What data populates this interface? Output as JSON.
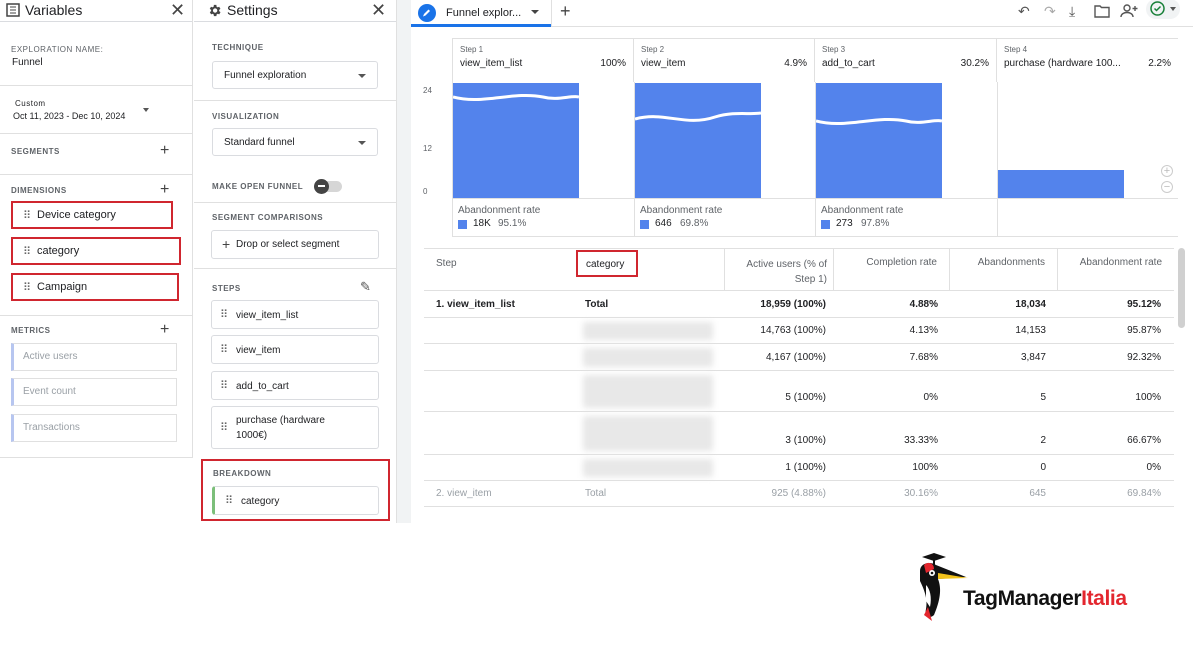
{
  "variables": {
    "title": "Variables",
    "exploration_name_label": "EXPLORATION NAME:",
    "exploration_name": "Funnel",
    "date_label": "Custom",
    "date_range": "Oct 11, 2023 - Dec 10, 2024",
    "segments_label": "SEGMENTS",
    "dimensions_label": "DIMENSIONS",
    "dimensions": [
      "Device category",
      "category",
      "Campaign"
    ],
    "metrics_label": "METRICS",
    "metrics": [
      "Active users",
      "Event count",
      "Transactions"
    ]
  },
  "settings": {
    "title": "Settings",
    "technique_label": "TECHNIQUE",
    "technique": "Funnel exploration",
    "visualization_label": "VISUALIZATION",
    "visualization": "Standard funnel",
    "open_funnel_label": "MAKE OPEN FUNNEL",
    "segment_comparisons_label": "SEGMENT COMPARISONS",
    "segment_drop": "Drop or select segment",
    "steps_label": "STEPS",
    "steps": [
      "view_item_list",
      "view_item",
      "add_to_cart",
      "purchase (hardware 1000€)"
    ],
    "breakdown_label": "BREAKDOWN",
    "breakdown": "category"
  },
  "main": {
    "tab_label": "Funnel explor...",
    "y_ticks": [
      "24",
      "12",
      "0"
    ],
    "steps": [
      {
        "step": "Step 1",
        "name": "view_item_list",
        "pct": "100%",
        "bar": 1.0,
        "abandon_label": "Abandonment rate",
        "abandon_value": "18K",
        "abandon_rate": "95.1%"
      },
      {
        "step": "Step 2",
        "name": "view_item",
        "pct": "4.9%",
        "bar": 1.0,
        "abandon_label": "Abandonment rate",
        "abandon_value": "646",
        "abandon_rate": "69.8%"
      },
      {
        "step": "Step 3",
        "name": "add_to_cart",
        "pct": "30.2%",
        "bar": 1.0,
        "abandon_label": "Abandonment rate",
        "abandon_value": "273",
        "abandon_rate": "97.8%"
      },
      {
        "step": "Step 4",
        "name": "purchase (hardware 100...",
        "pct": "2.2%",
        "bar": 0.24
      }
    ],
    "table": {
      "headers": [
        "Step",
        "category",
        "Active users (% of Step 1)",
        "Completion rate",
        "Abandonments",
        "Abandonment rate"
      ],
      "rows": [
        {
          "step": "1. view_item_list",
          "category": "Total",
          "active": "18,959 (100%)",
          "completion": "4.88%",
          "abandonments": "18,034",
          "rate": "95.12%"
        },
        {
          "step": "",
          "category": "",
          "active": "14,763 (100%)",
          "completion": "4.13%",
          "abandonments": "14,153",
          "rate": "95.87%"
        },
        {
          "step": "",
          "category": "",
          "active": "4,167 (100%)",
          "completion": "7.68%",
          "abandonments": "3,847",
          "rate": "92.32%"
        },
        {
          "step": "",
          "category": "",
          "active": "5 (100%)",
          "completion": "0%",
          "abandonments": "5",
          "rate": "100%"
        },
        {
          "step": "",
          "category": "",
          "active": "3 (100%)",
          "completion": "33.33%",
          "abandonments": "2",
          "rate": "66.67%"
        },
        {
          "step": "",
          "category": "",
          "active": "1 (100%)",
          "completion": "100%",
          "abandonments": "0",
          "rate": "0%"
        },
        {
          "step": "2. view_item",
          "category": "Total",
          "active": "925 (4.88%)",
          "completion": "30.16%",
          "abandonments": "645",
          "rate": "69.84%"
        }
      ]
    }
  },
  "logo": {
    "part1": "TagManager",
    "part2": "Italia"
  },
  "colors": {
    "bar": "#5383ec",
    "highlight": "#d0262f",
    "logo_red": "#e3262e"
  }
}
